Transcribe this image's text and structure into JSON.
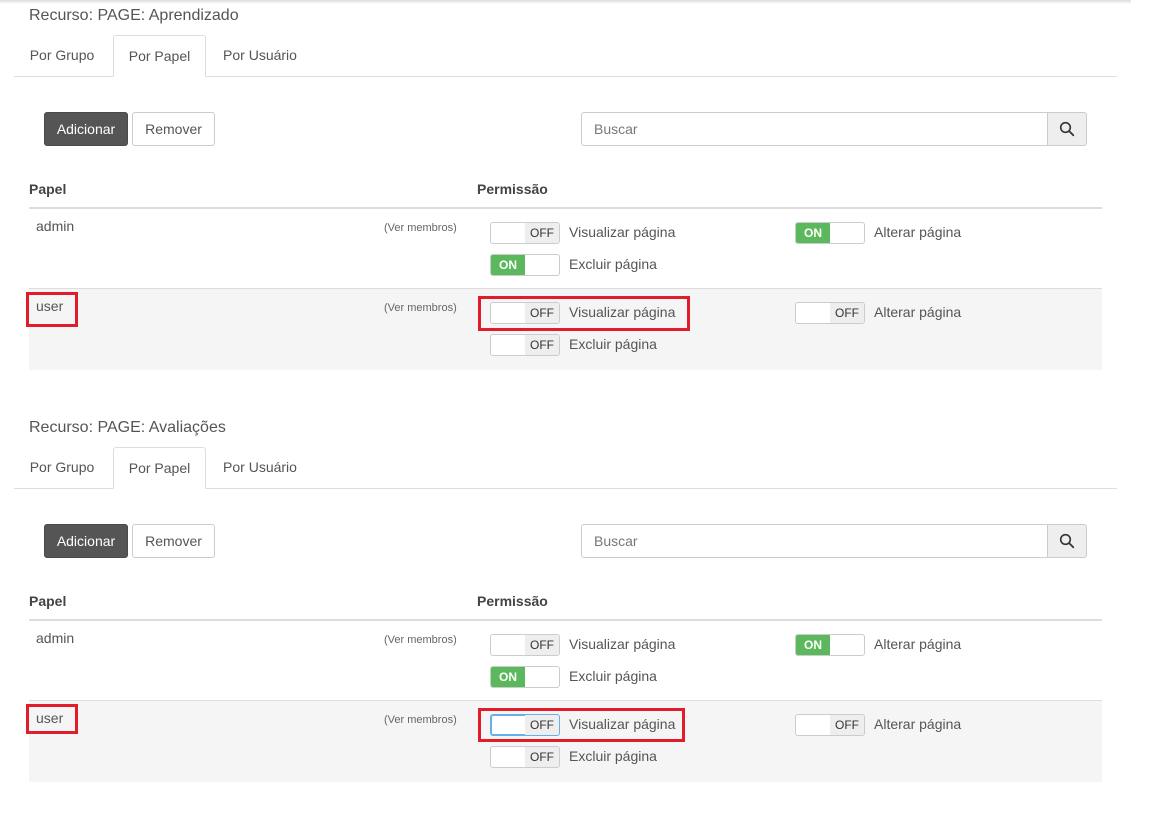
{
  "colors": {
    "highlight": "#e21c2a",
    "switch_on": "#5cb85c",
    "primary_button": "#555555"
  },
  "icons": {
    "search": "search-icon"
  },
  "sections": [
    {
      "title": "Recurso: PAGE: Aprendizado",
      "tabs": [
        {
          "label": "Por Grupo",
          "active": false
        },
        {
          "label": "Por Papel",
          "active": true
        },
        {
          "label": "Por Usuário",
          "active": false
        }
      ],
      "add_label": "Adicionar",
      "remove_label": "Remover",
      "search_placeholder": "Buscar",
      "col_role": "Papel",
      "col_permission": "Permissão",
      "rows": [
        {
          "role": "admin",
          "members_link": "(Ver membros)",
          "perms": [
            {
              "label": "Visualizar página",
              "state": "OFF"
            },
            {
              "label": "Alterar página",
              "state": "ON"
            },
            {
              "label": "Excluir página",
              "state": "ON"
            }
          ]
        },
        {
          "role": "user",
          "members_link": "(Ver membros)",
          "perms": [
            {
              "label": "Visualizar página",
              "state": "OFF"
            },
            {
              "label": "Alterar página",
              "state": "OFF"
            },
            {
              "label": "Excluir página",
              "state": "OFF"
            }
          ]
        }
      ]
    },
    {
      "title": "Recurso: PAGE: Avaliações",
      "tabs": [
        {
          "label": "Por Grupo",
          "active": false
        },
        {
          "label": "Por Papel",
          "active": true
        },
        {
          "label": "Por Usuário",
          "active": false
        }
      ],
      "add_label": "Adicionar",
      "remove_label": "Remover",
      "search_placeholder": "Buscar",
      "col_role": "Papel",
      "col_permission": "Permissão",
      "rows": [
        {
          "role": "admin",
          "members_link": "(Ver membros)",
          "perms": [
            {
              "label": "Visualizar página",
              "state": "OFF"
            },
            {
              "label": "Alterar página",
              "state": "ON"
            },
            {
              "label": "Excluir página",
              "state": "ON"
            }
          ]
        },
        {
          "role": "user",
          "members_link": "(Ver membros)",
          "perms": [
            {
              "label": "Visualizar página",
              "state": "OFF"
            },
            {
              "label": "Alterar página",
              "state": "OFF"
            },
            {
              "label": "Excluir página",
              "state": "OFF"
            }
          ]
        }
      ]
    }
  ]
}
